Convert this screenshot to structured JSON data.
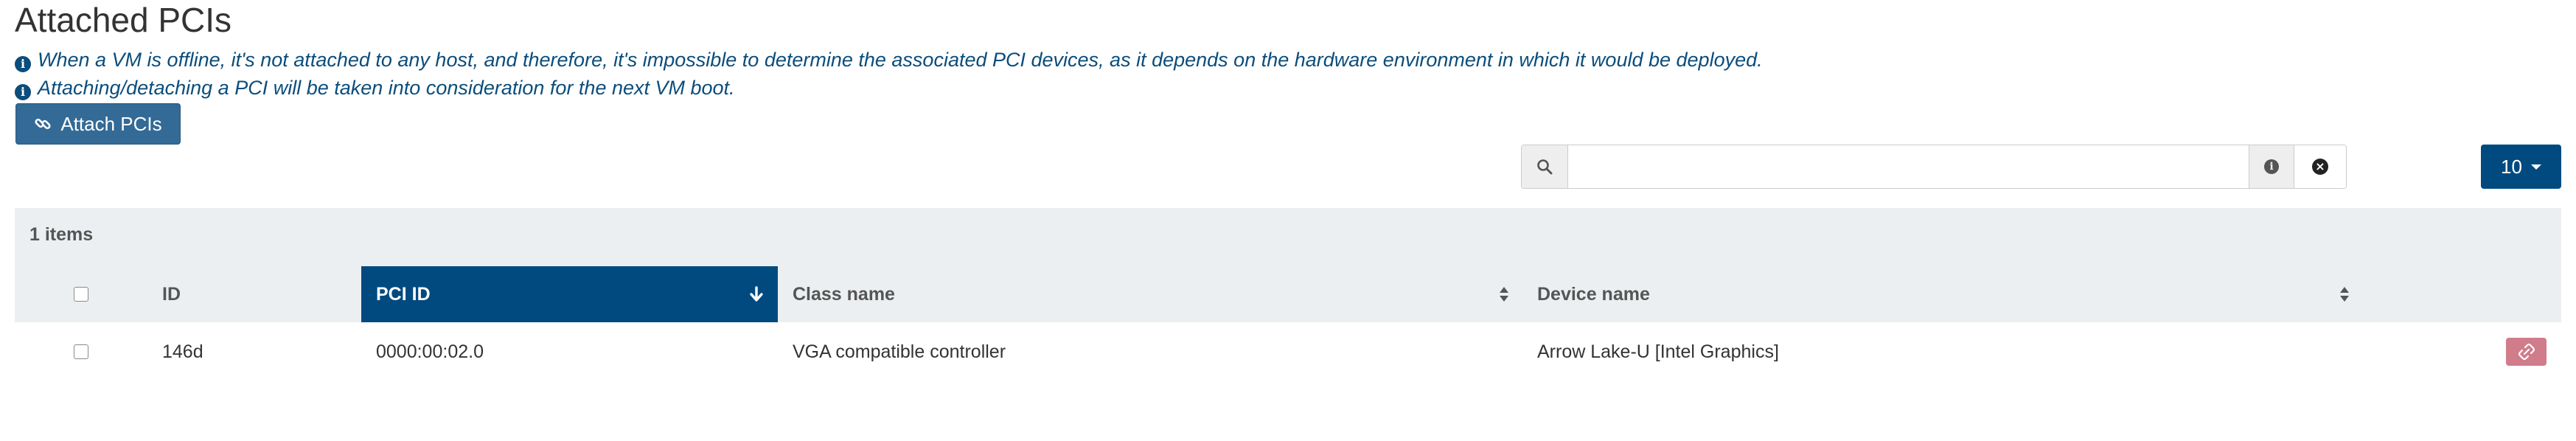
{
  "page": {
    "title": "Attached PCIs",
    "info_lines": [
      "When a VM is offline, it's not attached to any host, and therefore, it's impossible to determine the associated PCI devices, as it depends on the hardware environment in which it would be deployed.",
      "Attaching/detaching a PCI will be taken into consideration for the next VM boot."
    ]
  },
  "toolbar": {
    "attach_label": "Attach PCIs",
    "search": {
      "value": "",
      "placeholder": ""
    },
    "page_size": "10"
  },
  "table": {
    "items_count": "1 items",
    "columns": [
      "ID",
      "PCI ID",
      "Class name",
      "Device name"
    ],
    "sorted_column": "PCI ID",
    "rows": [
      {
        "id": "146d",
        "pci_id": "0000:00:02.0",
        "class_name": "VGA compatible controller",
        "device_name": "Arrow Lake-U [Intel Graphics]"
      }
    ]
  },
  "icons": {
    "info": "info-circle-icon",
    "link": "link-icon",
    "search": "search-icon",
    "clear": "times-circle-icon",
    "sort_active": "arrow-down-icon",
    "sort": "sort-icon",
    "detach": "unlink-icon"
  },
  "colors": {
    "primary": "#004a80",
    "button": "#336a96",
    "info_text": "#0b4d7c",
    "danger": "#d07c8b",
    "table_bg": "#eceff1"
  }
}
